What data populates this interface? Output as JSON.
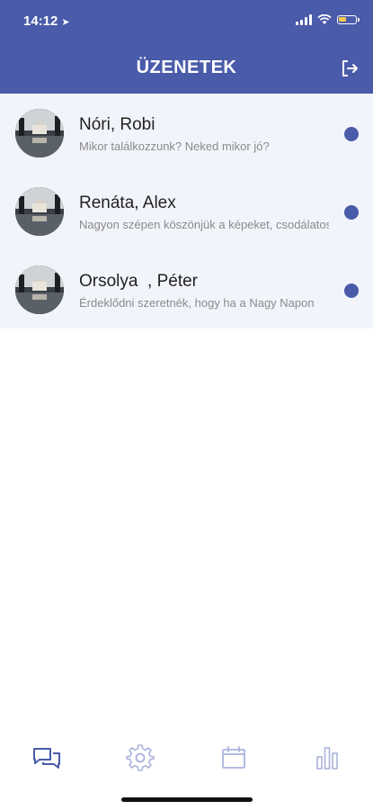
{
  "status": {
    "time": "14:12",
    "location_icon": "location-arrow-icon"
  },
  "header": {
    "title": "ÜZENETEK",
    "logout_icon": "logout-icon"
  },
  "conversations": [
    {
      "name": "Nóri, Robi",
      "preview": "Mikor találkozzunk? Neked mikor jó?",
      "unread": true
    },
    {
      "name": "Renáta, Alex",
      "preview": "Nagyon szépen köszönjük a képeket, csodálatosak",
      "unread": true
    },
    {
      "name": "Orsolya  , Péter",
      "preview": "Érdeklődni szeretnék, hogy ha a Nagy Napon",
      "unread": true
    }
  ],
  "tabbar": {
    "items": [
      {
        "icon": "chat-icon",
        "active": true
      },
      {
        "icon": "gear-icon",
        "active": false
      },
      {
        "icon": "calendar-icon",
        "active": false
      },
      {
        "icon": "bar-chart-icon",
        "active": false
      }
    ]
  },
  "colors": {
    "brand": "#4a5ba9",
    "list_bg": "#f2f4fb",
    "tab_inactive": "#aab3dc"
  }
}
